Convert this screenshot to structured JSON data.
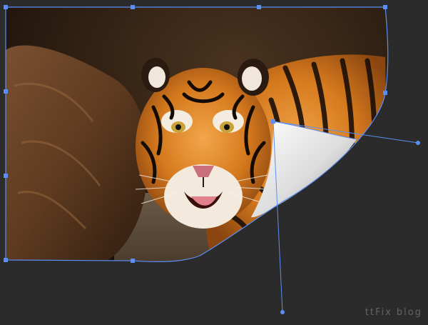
{
  "watermark": {
    "text": "ttFix blog"
  },
  "colors": {
    "background": "#2b2b2b",
    "selection_path": "#5b8ff5",
    "anchor_point": "#5b8ff5",
    "page_curl_light": "#f2f2f2",
    "page_curl_shadow": "#8c8c8c"
  },
  "icons": {
    "anchor": "square-anchor-point",
    "handle": "bezier-handle-dot"
  }
}
